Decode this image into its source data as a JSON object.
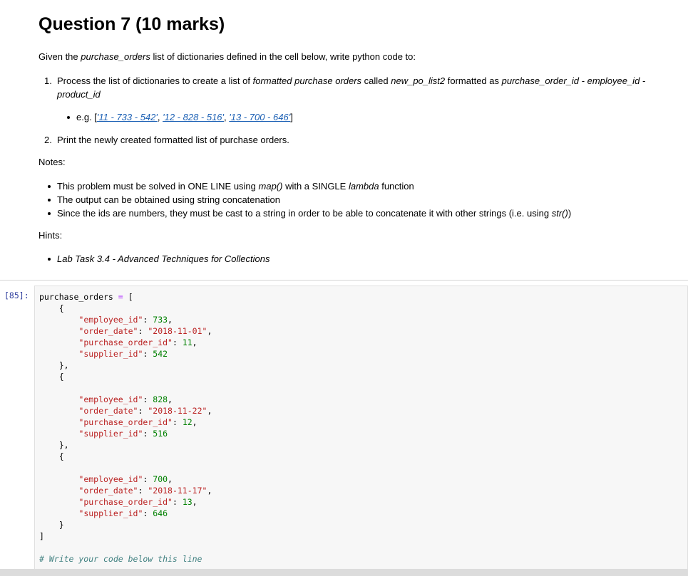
{
  "question": {
    "title": "Question 7 (10 marks)",
    "intro": {
      "p1": "Given the ",
      "p2": "purchase_orders",
      "p3": " list of dictionaries defined in the cell below, write python code to:"
    },
    "step1": {
      "num": "1.",
      "a": "Process the list of dictionaries to create a list of ",
      "b": "formatted purchase orders",
      "c": " called ",
      "d": "new_po_list2",
      "e": " formatted as ",
      "f": "purchase_order_id - employee_id - product_id"
    },
    "example": {
      "prefix": "e.g. [",
      "l1": "'11 - 733 - 542'",
      "sep1": ", ",
      "l2": "'12 - 828 - 516'",
      "sep2": ", ",
      "l3": "'13 - 700 - 646'",
      "suffix": "]"
    },
    "step2": {
      "num": "2.",
      "text": "Print the newly created formatted list of purchase orders."
    },
    "notes_label": "Notes:",
    "note1": {
      "a": "This problem must be solved in ONE LINE using ",
      "b": "map()",
      "c": " with a SINGLE ",
      "d": "lambda",
      "e": " function"
    },
    "note2": "The output can be obtained using string concatenation",
    "note3": {
      "a": "Since the ids are numbers, they must be cast to a string in order to be able to concatenate it with other strings (i.e. using ",
      "b": "str()",
      "c": ")"
    },
    "hints_label": "Hints:",
    "hint1": "Lab Task 3.4 - Advanced Techniques for Collections"
  },
  "cell": {
    "prompt": "[85]:",
    "var_name": "purchase_orders",
    "keys": {
      "employee_id": "\"employee_id\"",
      "order_date": "\"order_date\"",
      "purchase_order_id": "\"purchase_order_id\"",
      "supplier_id": "\"supplier_id\""
    },
    "orders": [
      {
        "employee_id": "733",
        "order_date": "\"2018-11-01\"",
        "purchase_order_id": "11",
        "supplier_id": "542"
      },
      {
        "employee_id": "828",
        "order_date": "\"2018-11-22\"",
        "purchase_order_id": "12",
        "supplier_id": "516"
      },
      {
        "employee_id": "700",
        "order_date": "\"2018-11-17\"",
        "purchase_order_id": "13",
        "supplier_id": "646"
      }
    ],
    "comment": "# Write your code below this line"
  }
}
